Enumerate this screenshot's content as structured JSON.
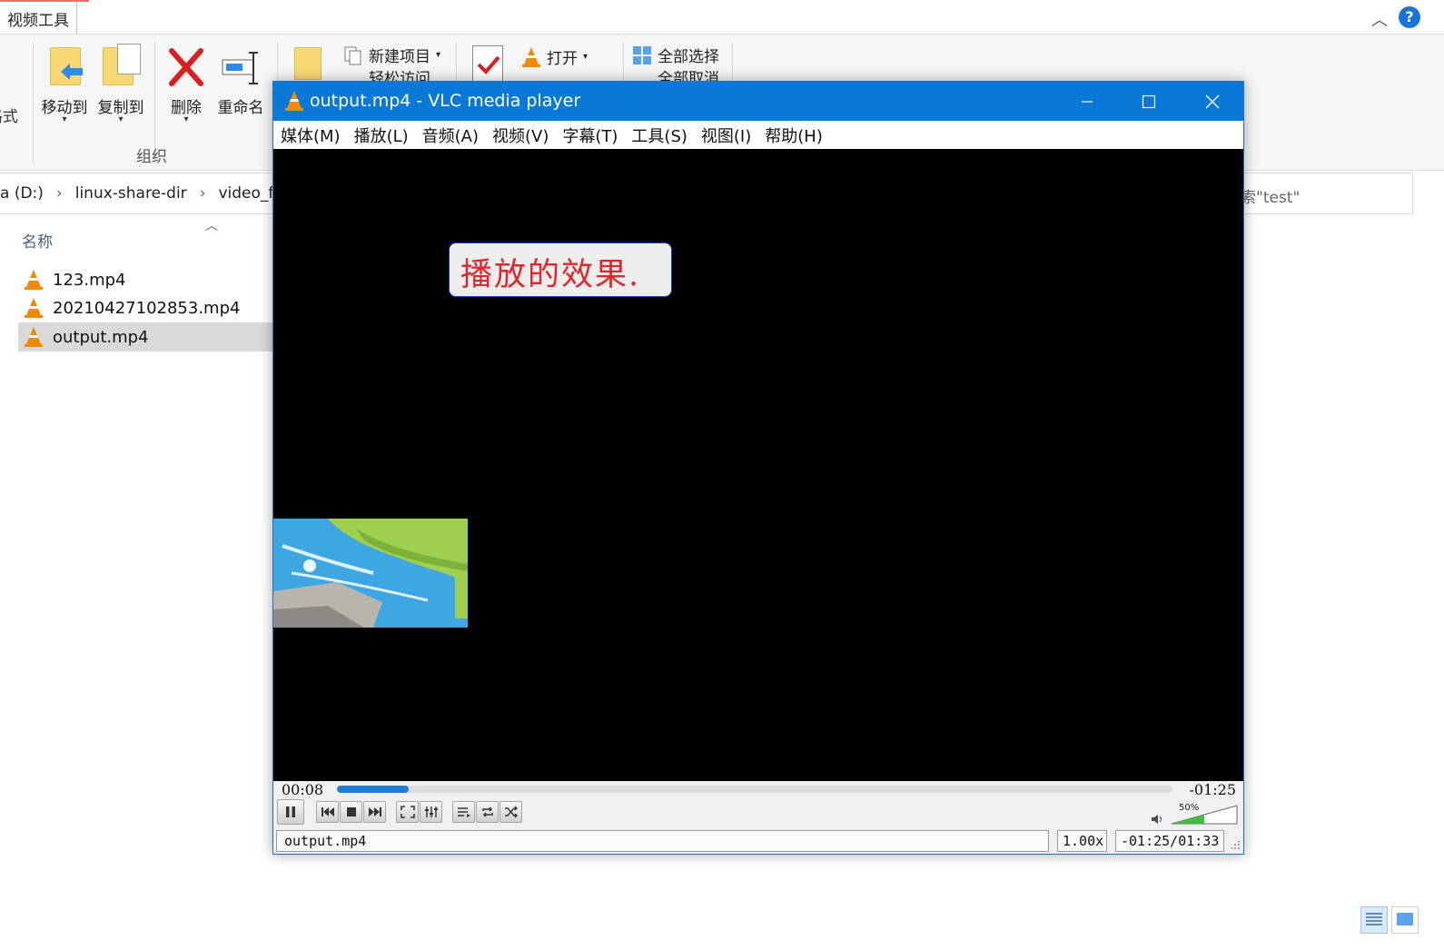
{
  "explorer": {
    "context_tab": "视频工具",
    "ribbon": {
      "clip_text": "格式",
      "move_to": "移动到",
      "copy_to": "复制到",
      "delete": "删除",
      "rename": "重命名",
      "group_organize": "组织",
      "new_item": "新建项目",
      "easy_access": "轻松访问",
      "open": "打开",
      "select_all": "全部选择",
      "select_none": "全部取消"
    },
    "address": {
      "crumbs": [
        "a (D:)",
        "linux-share-dir",
        "video_fil"
      ],
      "search_text": "索\"test\""
    },
    "list": {
      "column_name": "名称",
      "files": [
        {
          "name": "123.mp4",
          "selected": false
        },
        {
          "name": "20210427102853.mp4",
          "selected": false
        },
        {
          "name": "output.mp4",
          "selected": true
        }
      ]
    }
  },
  "vlc": {
    "title": "output.mp4 - VLC media player",
    "menu": [
      "媒体(M)",
      "播放(L)",
      "音频(A)",
      "视频(V)",
      "字幕(T)",
      "工具(S)",
      "视图(I)",
      "帮助(H)"
    ],
    "subtitle": "播放的效果.",
    "elapsed": "00:08",
    "remaining": "-01:25",
    "progress": 0.086,
    "volume_label": "50%",
    "volume": 0.5,
    "status_file": "output.mp4",
    "speed": "1.00x",
    "time_total": "-01:25/01:33",
    "colors": {
      "titlebar": "#0a78d7",
      "subtitle_text": "#e0262a",
      "progress": "#1f7ed8",
      "volume": "#3fbf3f"
    },
    "icons": [
      "vlc-cone-icon",
      "minimize-icon",
      "maximize-icon",
      "close-icon",
      "pause-icon",
      "previous-icon",
      "stop-icon",
      "next-icon",
      "fullscreen-icon",
      "extended-settings-icon",
      "playlist-icon",
      "loop-icon",
      "shuffle-icon",
      "speaker-icon"
    ]
  }
}
